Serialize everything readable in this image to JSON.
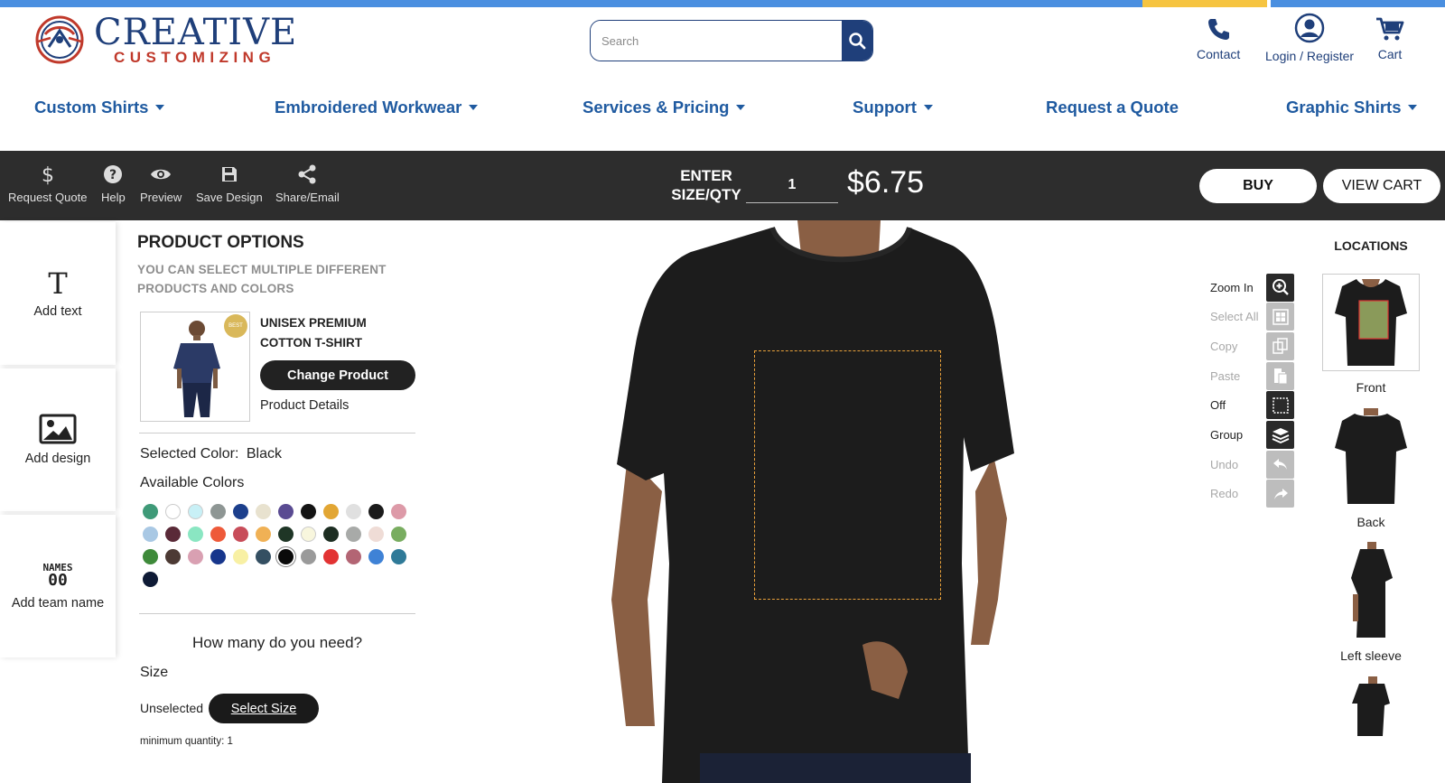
{
  "header": {
    "brand_line1": "CREATIVE",
    "brand_line2": "CUSTOMIZING",
    "search_placeholder": "Search",
    "links": [
      {
        "label": "Contact",
        "icon": "phone-icon"
      },
      {
        "label": "Login / Register",
        "icon": "user-icon"
      },
      {
        "label": "Cart",
        "icon": "cart-icon"
      }
    ]
  },
  "nav": [
    {
      "label": "Custom Shirts",
      "dropdown": true
    },
    {
      "label": "Embroidered Workwear",
      "dropdown": true
    },
    {
      "label": "Services & Pricing",
      "dropdown": true
    },
    {
      "label": "Support",
      "dropdown": true
    },
    {
      "label": "Request a Quote",
      "dropdown": false
    },
    {
      "label": "Graphic Shirts",
      "dropdown": true
    }
  ],
  "toolbar": {
    "tools": [
      {
        "label": "Request Quote",
        "icon": "dollar-icon"
      },
      {
        "label": "Help",
        "icon": "help-icon"
      },
      {
        "label": "Preview",
        "icon": "eye-icon"
      },
      {
        "label": "Save Design",
        "icon": "save-icon"
      },
      {
        "label": "Share/Email",
        "icon": "share-icon"
      }
    ],
    "enter_label": "ENTER SIZE/QTY",
    "qty": "1",
    "price": "$6.75",
    "buy_label": "BUY",
    "view_cart_label": "VIEW CART"
  },
  "left_tools": [
    {
      "label": "Add text",
      "icon": "text-icon"
    },
    {
      "label": "Add design",
      "icon": "image-icon"
    },
    {
      "label": "Add team name",
      "icon": "team-name-icon",
      "icon_text_top": "NAMES",
      "icon_text_bottom": "00"
    }
  ],
  "product": {
    "title": "PRODUCT OPTIONS",
    "subtitle_line1": "YOU CAN SELECT MULTIPLE DIFFERENT",
    "subtitle_line2": "PRODUCTS AND COLORS",
    "name_line1": "UNISEX PREMIUM",
    "name_line2": "COTTON T-SHIRT",
    "badge": "BEST",
    "change_label": "Change Product",
    "details_label": "Product Details",
    "selected_color_label": "Selected Color:",
    "selected_color": "Black",
    "available_label": "Available Colors",
    "colors": [
      "#3f9a78",
      "#ffffff",
      "#c8f0f6",
      "#8e9694",
      "#1c3f8c",
      "#e8e2cf",
      "#5a4b92",
      "#141414",
      "#e2a634",
      "#e0e0e0",
      "#1b1b1b",
      "#dd9aa8",
      "#a9c8e4",
      "#5a2a38",
      "#8ae6c2",
      "#ee5a3a",
      "#c84d5a",
      "#f0b155",
      "#1f3626",
      "#f8f6dd",
      "#1d2e22",
      "#a8aaa8",
      "#efdcd6",
      "#79ad60",
      "#3e8a3a",
      "#4c3a34",
      "#d9a0b2",
      "#17368c",
      "#f8f0a4",
      "#344f62",
      "#0a0a0a",
      "#9a9a9a",
      "#e23333",
      "#b36574",
      "#3f82d6",
      "#2f7a98",
      "#0e1a35"
    ],
    "howmany": "How many do you need?",
    "size_label": "Size",
    "unselected": "Unselected",
    "select_size": "Select Size",
    "min_qty": "minimum quantity: 1"
  },
  "edit_tools": [
    {
      "label": "Zoom In",
      "icon": "zoom-in-icon",
      "enabled": true
    },
    {
      "label": "Select All",
      "icon": "select-all-icon",
      "enabled": false
    },
    {
      "label": "Copy",
      "icon": "copy-icon",
      "enabled": false
    },
    {
      "label": "Paste",
      "icon": "paste-icon",
      "enabled": false
    },
    {
      "label": "Off",
      "icon": "grid-off-icon",
      "enabled": true
    },
    {
      "label": "Group",
      "icon": "layers-icon",
      "enabled": true
    },
    {
      "label": "Undo",
      "icon": "undo-icon",
      "enabled": false
    },
    {
      "label": "Redo",
      "icon": "redo-icon",
      "enabled": false
    }
  ],
  "locations": {
    "title": "LOCATIONS",
    "items": [
      {
        "label": "Front",
        "selected": true
      },
      {
        "label": "Back",
        "selected": false
      },
      {
        "label": "Left sleeve",
        "selected": false
      },
      {
        "label": "",
        "selected": false
      }
    ]
  },
  "colors": {
    "brand_navy": "#1f3f7a",
    "brand_red": "#c0392b",
    "nav_blue": "#1f5aa0",
    "toolbar_bg": "#2d2d2d",
    "print_area": "#e9a13a"
  }
}
